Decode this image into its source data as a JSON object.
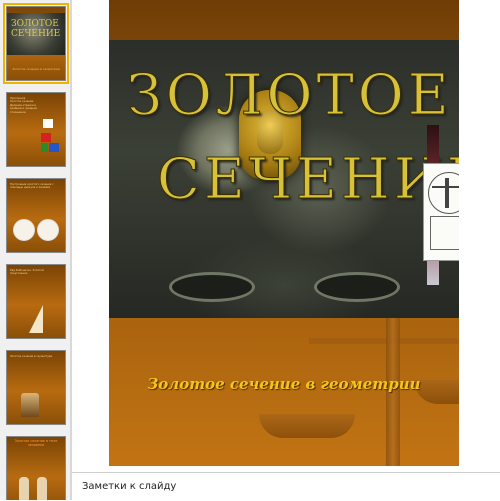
{
  "slide": {
    "title_line1": "ЗОЛОТОЕ",
    "title_line2": "СЕЧЕНИЕ",
    "subtitle": "Золотое сечение в геометрии"
  },
  "notes": {
    "placeholder": "Заметки к слайду"
  },
  "thumbnails": {
    "t1": {
      "title": "ЗОЛОТОЕ СЕЧЕНИЕ",
      "subtitle": "Золотое сечение в геометрии"
    },
    "t2": {
      "text": "Пропорция. Золотое сечение. Деление отрезка в крайнем и среднем отношении."
    },
    "t3": {
      "text": "Построение золотого сечения с помощью циркуля и линейки."
    },
    "t4": {
      "text": "Ряд Фибоначчи. Золотой треугольник."
    },
    "t5": {
      "text": "Золотое сечение в скульптуре."
    },
    "t6": {
      "title": "Золотое сечение в теле человека"
    }
  },
  "colors": {
    "slide_dark": "#6e3d06",
    "slide_light": "#c27414",
    "title_gold": "#d8c13a",
    "subtitle_yellow": "#f5c518",
    "selection": "#f2b300"
  }
}
